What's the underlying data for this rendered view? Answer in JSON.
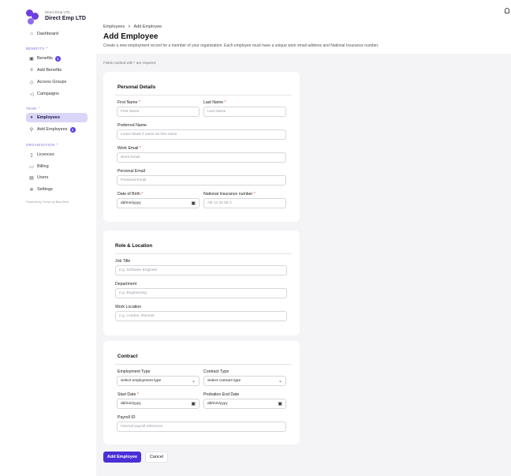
{
  "brand": {
    "small": "Direct Emp LTD",
    "name": "Direct Emp LTD"
  },
  "nav": {
    "dashboard": "Dashboard",
    "benefits_section": "BENEFITS ⌃",
    "benefits": "Benefits",
    "benefits_badge": "1",
    "add_benefits": "Add Benefits",
    "access_groups": "Access Groups",
    "campaigns": "Campaigns",
    "team_section": "TEAM ⌃",
    "employees": "Employees",
    "add_employees": "Add Employees",
    "add_employees_badge": "1",
    "org_section": "ORGANISATION ⌃",
    "licences": "Licences",
    "billing": "Billing",
    "users": "Users",
    "settings": "Settings",
    "powered": "Powered by Thrive by BacoTech"
  },
  "breadcrumb": {
    "parent": "Employees",
    "sep": ">",
    "current": "Add Employee"
  },
  "page": {
    "title": "Add Employee",
    "description": "Create a new employment record for a member of your organisation. Each employee must have a unique work email address and National Insurance number.",
    "required_note": "Fields marked with * are required."
  },
  "personal": {
    "title": "Personal Details",
    "first_name_label": "First Name",
    "first_name_placeholder": "First Name",
    "last_name_label": "Last Name",
    "last_name_placeholder": "Last Name",
    "preferred_label": "Preferred Name",
    "preferred_placeholder": "Leave blank if same as first name",
    "work_email_label": "Work Email",
    "work_email_placeholder": "Work Email",
    "personal_email_label": "Personal Email",
    "personal_email_placeholder": "Personal Email",
    "dob_label": "Date of Birth",
    "dob_value": "dd/mm/yyyy",
    "ni_label": "National Insurance number",
    "ni_placeholder": "AB 12 34 56 C"
  },
  "role": {
    "title": "Role & Location",
    "job_title_label": "Job Title",
    "job_title_placeholder": "e.g. Software Engineer",
    "department_label": "Department",
    "department_placeholder": "e.g. Engineering",
    "location_label": "Work Location",
    "location_placeholder": "e.g. London, Remote"
  },
  "contract": {
    "title": "Contract",
    "employment_type_label": "Employment Type",
    "employment_type_value": "Select employment type",
    "contract_type_label": "Contract Type",
    "contract_type_value": "Select contract type",
    "start_label": "Start Date",
    "start_value": "dd/mm/yyyy",
    "probation_label": "Probation End Date",
    "probation_value": "dd/mm/yyyy",
    "payroll_label": "Payroll ID",
    "payroll_placeholder": "Internal payroll reference"
  },
  "actions": {
    "submit": "Add Employee",
    "cancel": "Cancel"
  },
  "icons": {
    "calendar": "calendar-icon",
    "chevron": "chevron-down-icon",
    "bell": "bell-icon"
  },
  "colors": {
    "accent": "#4a2fd6",
    "active_nav": "#d9d6f7",
    "required": "#e0483e"
  }
}
